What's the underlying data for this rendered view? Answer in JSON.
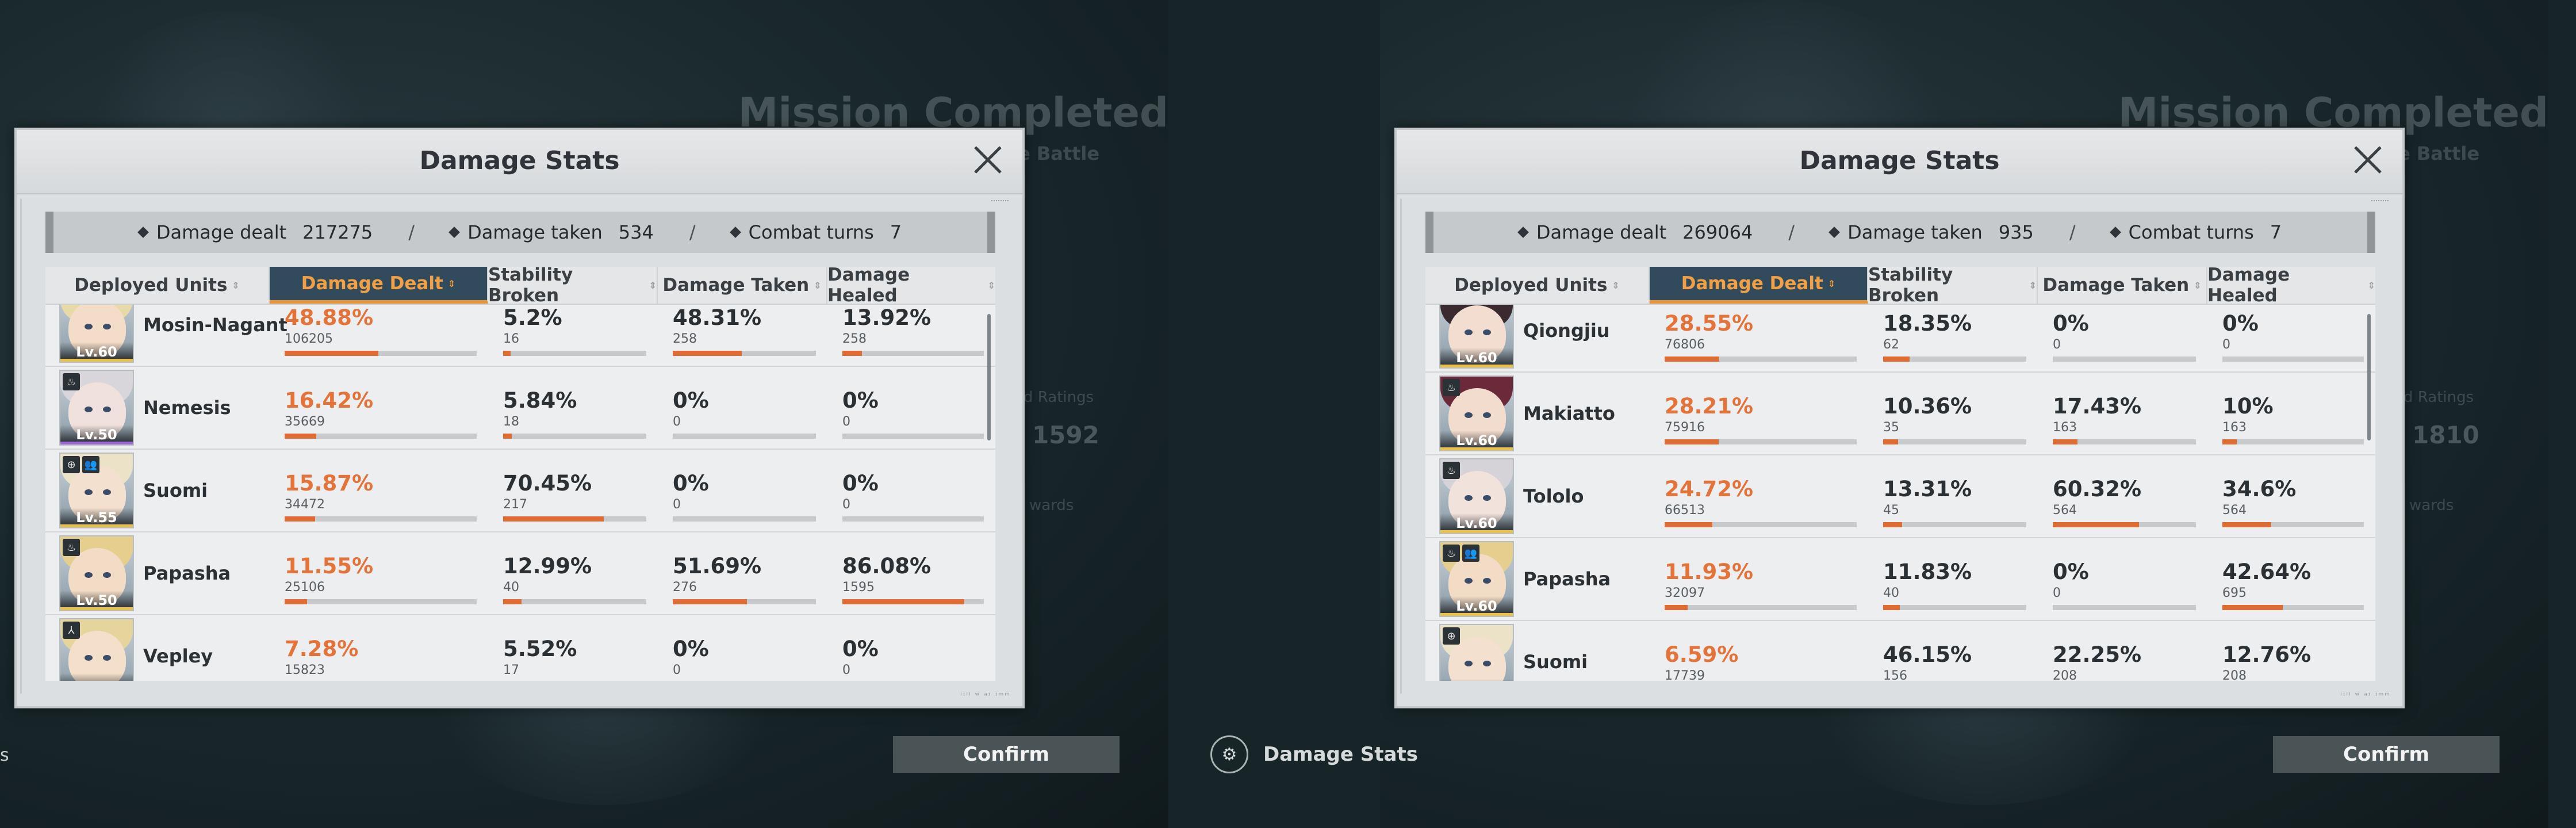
{
  "screens": [
    {
      "background": {
        "mission_title": "Mission Completed",
        "mission_sub": "e Battle",
        "rating_label": "d Ratings",
        "rating_value": "1592",
        "rewards_label": "wards",
        "confirm_label": "Confirm",
        "left_fragment": "s"
      },
      "panel": {
        "title": "Damage Stats",
        "summary": {
          "dealt_label": "Damage dealt",
          "dealt_value": "217275",
          "taken_label": "Damage taken",
          "taken_value": "534",
          "turns_label": "Combat turns",
          "turns_value": "7",
          "separator": "/"
        },
        "headers": [
          "Deployed Units",
          "Damage Dealt",
          "Stability Broken",
          "Damage Taken",
          "Damage Healed"
        ],
        "active_header": "Damage Dealt",
        "rows": [
          {
            "name": "Mosin-Nagant",
            "level": "Lv.60",
            "role": "",
            "team": false,
            "hair": "#e8d9a8",
            "skin": "#f3dcc8",
            "rarity": "#e8c04a",
            "dd_pct": "48.88%",
            "dd_raw": "106205",
            "dd_fill": 0.4888,
            "sb_pct": "5.2%",
            "sb_raw": "16",
            "sb_fill": 0.052,
            "dt_pct": "48.31%",
            "dt_raw": "258",
            "dt_fill": 0.4831,
            "dh_pct": "13.92%",
            "dh_raw": "258",
            "dh_fill": 0.1392
          },
          {
            "name": "Nemesis",
            "level": "Lv.50",
            "role": "♨",
            "team": false,
            "hair": "#d9d6db",
            "skin": "#f1e1dd",
            "rarity": "#9b6ad6",
            "dd_pct": "16.42%",
            "dd_raw": "35669",
            "dd_fill": 0.1642,
            "sb_pct": "5.84%",
            "sb_raw": "18",
            "sb_fill": 0.0584,
            "dt_pct": "0%",
            "dt_raw": "0",
            "dt_fill": 0,
            "dh_pct": "0%",
            "dh_raw": "0",
            "dh_fill": 0
          },
          {
            "name": "Suomi",
            "level": "Lv.55",
            "role": "⊕",
            "team": true,
            "hair": "#ece2c8",
            "skin": "#f4e0cf",
            "rarity": "#e8c04a",
            "dd_pct": "15.87%",
            "dd_raw": "34472",
            "dd_fill": 0.1587,
            "sb_pct": "70.45%",
            "sb_raw": "217",
            "sb_fill": 0.7045,
            "dt_pct": "0%",
            "dt_raw": "0",
            "dt_fill": 0,
            "dh_pct": "0%",
            "dh_raw": "0",
            "dh_fill": 0
          },
          {
            "name": "Papasha",
            "level": "Lv.50",
            "role": "♨",
            "team": false,
            "hair": "#e6cf8e",
            "skin": "#f2dcc6",
            "rarity": "#e8c04a",
            "dd_pct": "11.55%",
            "dd_raw": "25106",
            "dd_fill": 0.1155,
            "sb_pct": "12.99%",
            "sb_raw": "40",
            "sb_fill": 0.1299,
            "dt_pct": "51.69%",
            "dt_raw": "276",
            "dt_fill": 0.5169,
            "dh_pct": "86.08%",
            "dh_raw": "1595",
            "dh_fill": 0.8608
          },
          {
            "name": "Vepley",
            "level": "",
            "role": "⅄",
            "team": false,
            "hair": "#e5d49c",
            "skin": "#f3dfca",
            "rarity": "#e8c04a",
            "dd_pct": "7.28%",
            "dd_raw": "15823",
            "dd_fill": 0.0728,
            "sb_pct": "5.52%",
            "sb_raw": "17",
            "sb_fill": 0.0552,
            "dt_pct": "0%",
            "dt_raw": "0",
            "dt_fill": 0,
            "dh_pct": "0%",
            "dh_raw": "0",
            "dh_fill": 0
          }
        ]
      }
    },
    {
      "background": {
        "mission_title": "Mission Completed",
        "mission_sub": "e Battle",
        "rating_label": "d Ratings",
        "rating_value": "1810",
        "rewards_label": "wards",
        "confirm_label": "Confirm",
        "damage_stats_link": "Damage Stats"
      },
      "panel": {
        "title": "Damage Stats",
        "summary": {
          "dealt_label": "Damage dealt",
          "dealt_value": "269064",
          "taken_label": "Damage taken",
          "taken_value": "935",
          "turns_label": "Combat turns",
          "turns_value": "7",
          "separator": "/"
        },
        "headers": [
          "Deployed Units",
          "Damage Dealt",
          "Stability Broken",
          "Damage Taken",
          "Damage Healed"
        ],
        "active_header": "Damage Dealt",
        "rows": [
          {
            "name": "Qiongjiu",
            "level": "Lv.60",
            "role": "",
            "team": false,
            "hair": "#3a2a30",
            "skin": "#f2ddd0",
            "rarity": "#e8c04a",
            "dd_pct": "28.55%",
            "dd_raw": "76806",
            "dd_fill": 0.2855,
            "sb_pct": "18.35%",
            "sb_raw": "62",
            "sb_fill": 0.1835,
            "dt_pct": "0%",
            "dt_raw": "0",
            "dt_fill": 0,
            "dh_pct": "0%",
            "dh_raw": "0",
            "dh_fill": 0
          },
          {
            "name": "Makiatto",
            "level": "Lv.60",
            "role": "♨",
            "team": false,
            "hair": "#6a2a3a",
            "skin": "#f2dccd",
            "rarity": "#e8c04a",
            "dd_pct": "28.21%",
            "dd_raw": "75916",
            "dd_fill": 0.2821,
            "sb_pct": "10.36%",
            "sb_raw": "35",
            "sb_fill": 0.1036,
            "dt_pct": "17.43%",
            "dt_raw": "163",
            "dt_fill": 0.1743,
            "dh_pct": "10%",
            "dh_raw": "163",
            "dh_fill": 0.1
          },
          {
            "name": "Tololo",
            "level": "Lv.60",
            "role": "♨",
            "team": false,
            "hair": "#d5d2d8",
            "skin": "#f2e2dc",
            "rarity": "#e8c04a",
            "dd_pct": "24.72%",
            "dd_raw": "66513",
            "dd_fill": 0.2472,
            "sb_pct": "13.31%",
            "sb_raw": "45",
            "sb_fill": 0.1331,
            "dt_pct": "60.32%",
            "dt_raw": "564",
            "dt_fill": 0.6032,
            "dh_pct": "34.6%",
            "dh_raw": "564",
            "dh_fill": 0.346
          },
          {
            "name": "Papasha",
            "level": "Lv.60",
            "role": "♨",
            "team": true,
            "hair": "#e6cf8e",
            "skin": "#f2dcc6",
            "rarity": "#e8c04a",
            "dd_pct": "11.93%",
            "dd_raw": "32097",
            "dd_fill": 0.1193,
            "sb_pct": "11.83%",
            "sb_raw": "40",
            "sb_fill": 0.1183,
            "dt_pct": "0%",
            "dt_raw": "0",
            "dt_fill": 0,
            "dh_pct": "42.64%",
            "dh_raw": "695",
            "dh_fill": 0.4264
          },
          {
            "name": "Suomi",
            "level": "",
            "role": "⊕",
            "team": false,
            "hair": "#ece2c8",
            "skin": "#f4e0cf",
            "rarity": "#e8c04a",
            "dd_pct": "6.59%",
            "dd_raw": "17739",
            "dd_fill": 0.0659,
            "sb_pct": "46.15%",
            "sb_raw": "156",
            "sb_fill": 0.4615,
            "dt_pct": "22.25%",
            "dt_raw": "208",
            "dt_fill": 0.2225,
            "dh_pct": "12.76%",
            "dh_raw": "208",
            "dh_fill": 0.1276
          }
        ]
      }
    }
  ],
  "footer_text": "ⁱᶦˡˡ ʷ ᵃᶦ ᶦᵐᵐ"
}
